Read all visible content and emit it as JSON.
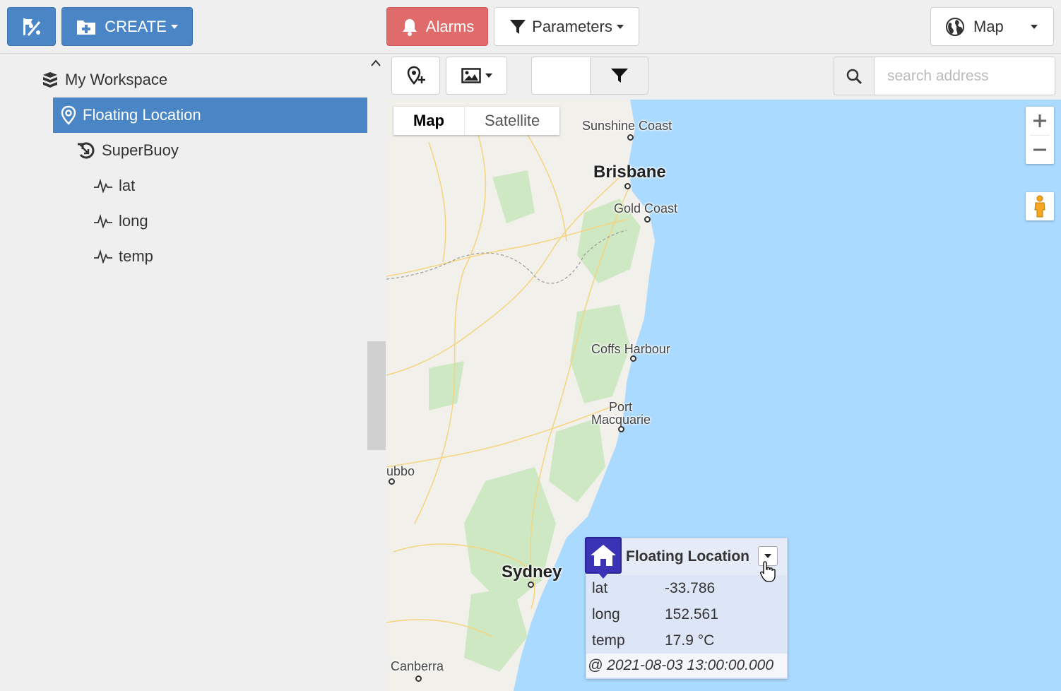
{
  "toolbar": {
    "create_label": "CREATE",
    "alarms_label": "Alarms",
    "parameters_label": "Parameters",
    "view_label": "Map"
  },
  "tree": {
    "workspace": "My Workspace",
    "selected": "Floating Location",
    "device": "SuperBuoy",
    "params": [
      "lat",
      "long",
      "temp"
    ]
  },
  "search": {
    "placeholder": "search address"
  },
  "map": {
    "type_map": "Map",
    "type_satellite": "Satellite",
    "places": {
      "sunshine": "Sunshine Coast",
      "brisbane": "Brisbane",
      "gold": "Gold Coast",
      "coffs": "Coffs Harbour",
      "port1": "Port",
      "port2": "Macquarie",
      "dubbo": "ubbo",
      "sydney": "Sydney",
      "canberra": "Canberra"
    }
  },
  "popup": {
    "title": "Floating Location",
    "rows": [
      {
        "key": "lat",
        "value": "-33.786"
      },
      {
        "key": "long",
        "value": "152.561"
      },
      {
        "key": "temp",
        "value": "17.9 °C"
      }
    ],
    "timestamp": "@ 2021-08-03 13:00:00.000"
  },
  "colors": {
    "primary": "#4a86c5",
    "alarm": "#e06b6b",
    "ocean": "#aadaff",
    "land": "#f2f0eb",
    "marker": "#3a33b5"
  }
}
